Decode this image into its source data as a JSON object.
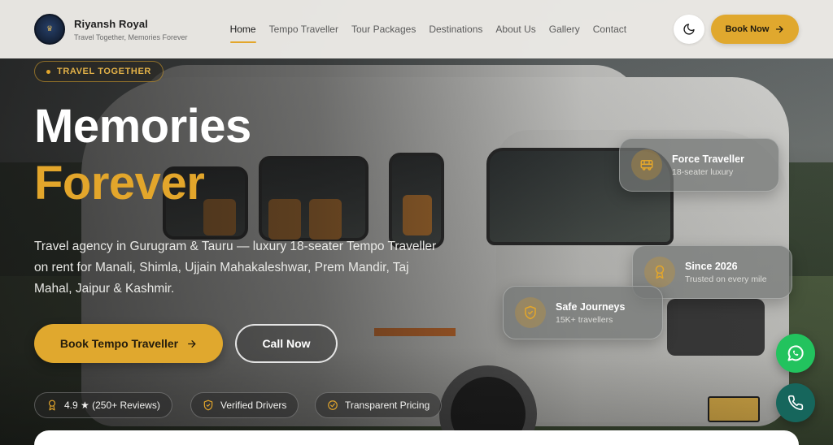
{
  "brand": {
    "name": "Riyansh Royal",
    "tagline": "Travel Together, Memories Forever"
  },
  "nav": {
    "items": [
      {
        "label": "Home",
        "active": true
      },
      {
        "label": "Tempo Traveller",
        "active": false
      },
      {
        "label": "Tour Packages",
        "active": false
      },
      {
        "label": "Destinations",
        "active": false
      },
      {
        "label": "About Us",
        "active": false
      },
      {
        "label": "Gallery",
        "active": false
      },
      {
        "label": "Contact",
        "active": false
      }
    ],
    "book_now_label": "Book Now",
    "theme_icon": "moon-icon"
  },
  "hero": {
    "badge": "TRAVEL TOGETHER",
    "headline_line1": "Memories",
    "headline_line2": "Forever",
    "description": "Travel agency in Gurugram & Tauru — luxury 18-seater Tempo Traveller on rent for Manali, Shimla, Ujjain Mahakaleshwar, Prem Mandir, Taj Mahal, Jaipur & Kashmir.",
    "cta_primary": "Book Tempo Traveller",
    "cta_secondary": "Call Now",
    "chips": [
      {
        "label": "4.9 ★ (250+ Reviews)",
        "icon": "award-icon"
      },
      {
        "label": "Verified Drivers",
        "icon": "shield-check-icon"
      },
      {
        "label": "Transparent Pricing",
        "icon": "badge-check-icon"
      }
    ]
  },
  "cards": [
    {
      "title": "Force Traveller",
      "subtitle": "18-seater luxury",
      "icon": "bus-icon"
    },
    {
      "title": "Since 2026",
      "subtitle": "Trusted on every mile",
      "icon": "award-icon"
    },
    {
      "title": "Safe Journeys",
      "subtitle": "15K+ travellers",
      "icon": "shield-check-icon"
    }
  ],
  "colors": {
    "accent": "#E0A82E",
    "whatsapp": "#22C35E",
    "call": "#16665C"
  }
}
